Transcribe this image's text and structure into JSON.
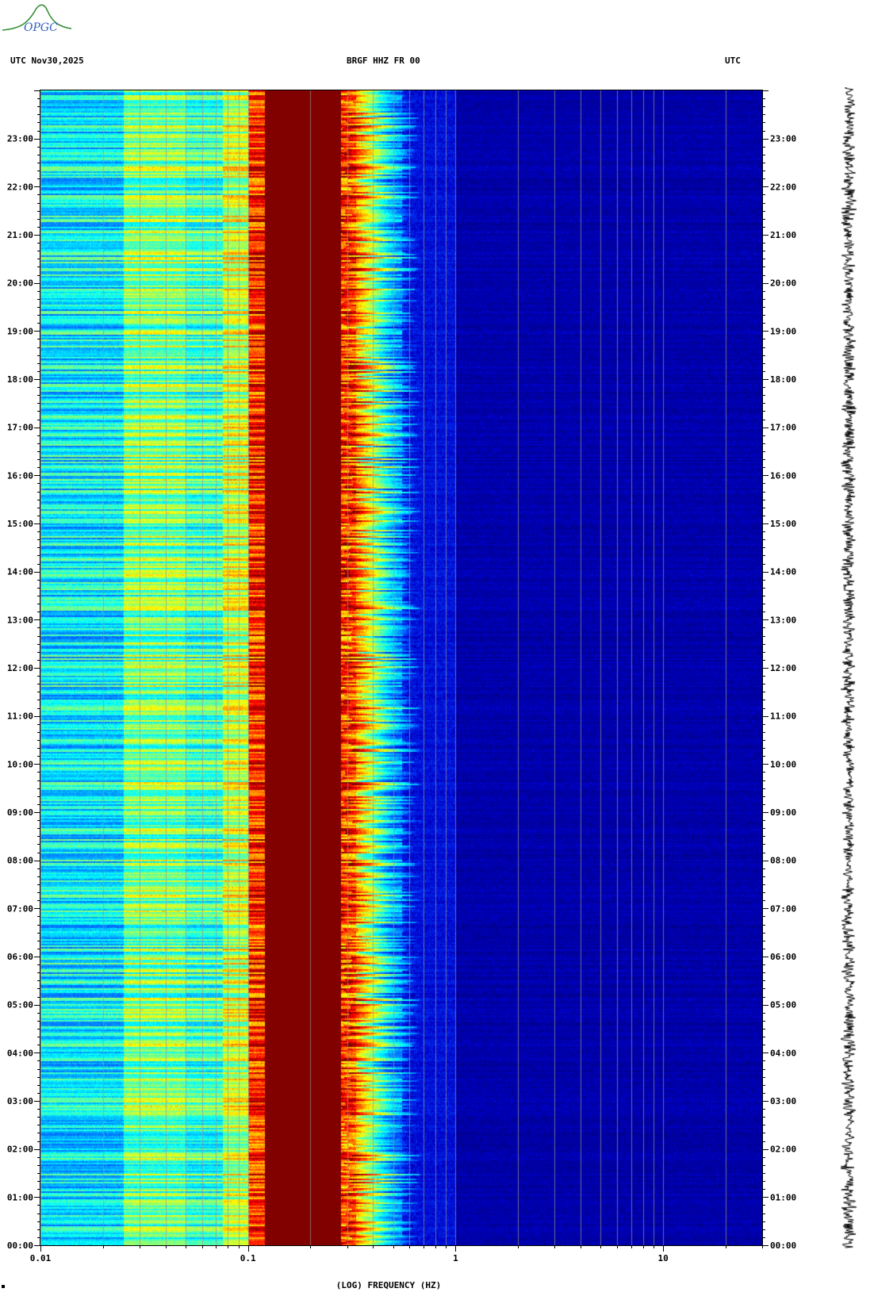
{
  "header": {
    "left": "UTC  Nov30,2025",
    "center": "BRGF HHZ FR 00",
    "right": "UTC"
  },
  "logo": {
    "text": "OPGC"
  },
  "colors": {
    "background": "#ffffff",
    "palette": [
      "#00007a",
      "#0000c8",
      "#0040ff",
      "#00a0ff",
      "#00ffff",
      "#80ff80",
      "#ffff00",
      "#ff8000",
      "#ff0000",
      "#800000"
    ]
  },
  "chart_data": {
    "type": "heatmap",
    "title": "BRGF HHZ FR 00",
    "xlabel": "(LOG) FREQUENCY (HZ)",
    "x_scale": "log",
    "xlim": [
      0.01,
      30
    ],
    "x_ticks": [
      "0.01",
      "0.1",
      "1",
      "10"
    ],
    "ylabel": "UTC",
    "y_ticks_left": [
      "23:00",
      "22:00",
      "21:00",
      "20:00",
      "19:00",
      "18:00",
      "17:00",
      "16:00",
      "15:00",
      "14:00",
      "13:00",
      "12:00",
      "11:00",
      "10:00",
      "09:00",
      "08:00",
      "07:00",
      "06:00",
      "05:00",
      "04:00",
      "03:00",
      "02:00",
      "01:00",
      "00:00"
    ],
    "y_ticks_right": [
      "23:00",
      "22:00",
      "21:00",
      "20:00",
      "19:00",
      "18:00",
      "17:00",
      "16:00",
      "15:00",
      "14:00",
      "13:00",
      "12:00",
      "11:00",
      "10:00",
      "09:00",
      "08:00",
      "07:00",
      "06:00",
      "05:00",
      "04:00",
      "03:00",
      "02:00",
      "01:00",
      "00:00"
    ],
    "ylim_hours": [
      0,
      24
    ],
    "frequency_bands_hz": [
      {
        "from": 0.01,
        "to": 0.025,
        "level": 0.42
      },
      {
        "from": 0.025,
        "to": 0.05,
        "level": 0.55
      },
      {
        "from": 0.05,
        "to": 0.075,
        "level": 0.5
      },
      {
        "from": 0.075,
        "to": 0.1,
        "level": 0.62
      },
      {
        "from": 0.1,
        "to": 0.12,
        "level": 0.85
      },
      {
        "from": 0.12,
        "to": 0.28,
        "level": 1.0
      },
      {
        "from": 0.28,
        "to": 0.33,
        "level": 0.8
      },
      {
        "from": 0.33,
        "to": 0.4,
        "level": 0.55
      },
      {
        "from": 0.4,
        "to": 0.55,
        "level": 0.3
      },
      {
        "from": 0.55,
        "to": 1.0,
        "level": 0.14
      },
      {
        "from": 1.0,
        "to": 30,
        "level": 0.07
      }
    ]
  }
}
